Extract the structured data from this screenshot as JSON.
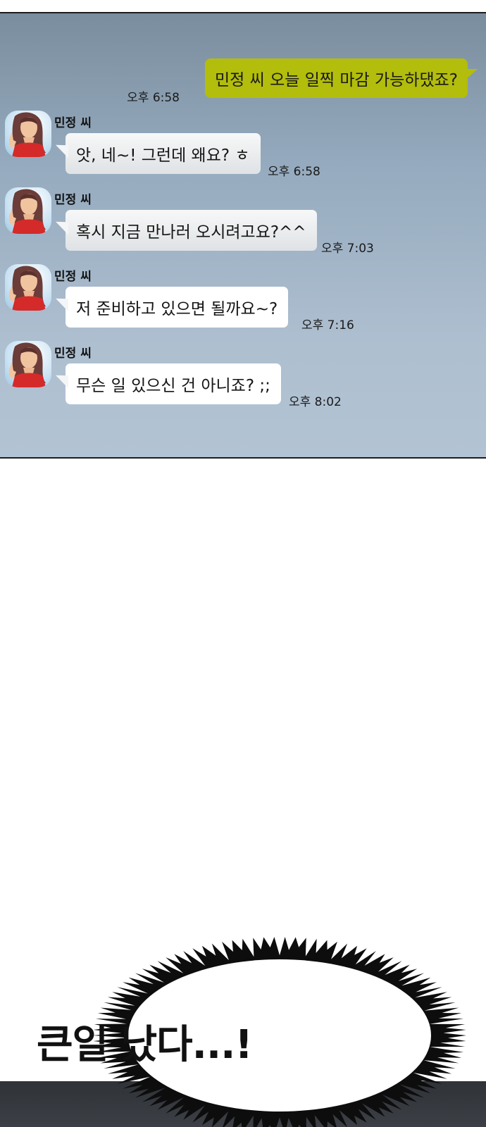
{
  "chat": {
    "sent_message": {
      "text": "민정 씨 오늘 일찍 마감 가능하댔죠?",
      "time": "오후 6:58"
    },
    "received_messages": [
      {
        "name": "민정 씨",
        "text": "앗, 네~! 그런데 왜요? ㅎ",
        "time": "오후 6:58"
      },
      {
        "name": "민정 씨",
        "text": "혹시 지금 만나러 오시려고요?^^",
        "time": "오후 7:03"
      },
      {
        "name": "민정 씨",
        "text": "저 준비하고 있으면 될까요~?",
        "time": "오후 7:16"
      },
      {
        "name": "민정 씨",
        "text": "무슨 일 있으신 건 아니죠? ;;",
        "time": "오후 8:02"
      }
    ],
    "colors": {
      "sent_bubble": "#b3bd0b",
      "received_bubble": "#ffffff",
      "background_top": "#7a8d9e",
      "background_bottom": "#b2c3d3"
    }
  },
  "narration": {
    "shout_text": "큰일 났다...!"
  }
}
